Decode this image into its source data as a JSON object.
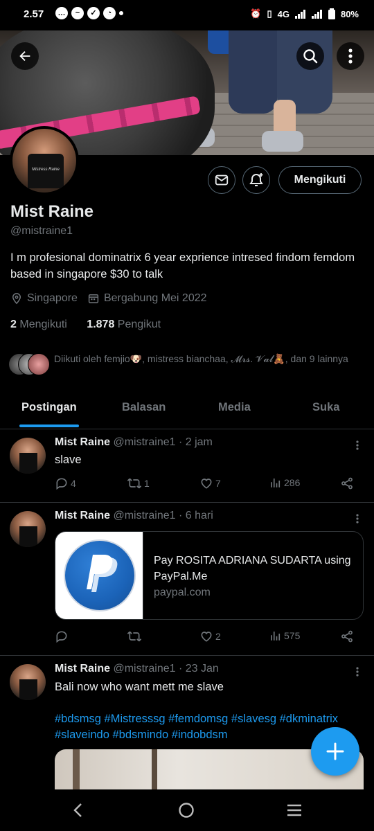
{
  "status_bar": {
    "time": "2.57",
    "battery": "80%",
    "network": "4G"
  },
  "profile": {
    "name": "Mist Raine",
    "handle": "@mistraine1",
    "bio": "I m profesional dominatrix 6 year exprience  intresed findom femdom based in singapore $30 to talk",
    "location": "Singapore",
    "joined": "Bergabung Mei 2022",
    "following_count": "2",
    "following_label": "Mengikuti",
    "followers_count": "1.878",
    "followers_label": "Pengikut",
    "follow_button": "Mengikuti",
    "avatar_caption": "Mistress Raine",
    "followed_by": "Diikuti oleh femjio🐶, mistress bianchaa, 𝓜𝓻𝓼. 𝓥𝓪𝓵🧸, dan 9 lainnya"
  },
  "tabs": [
    {
      "label": "Postingan",
      "active": true
    },
    {
      "label": "Balasan",
      "active": false
    },
    {
      "label": "Media",
      "active": false
    },
    {
      "label": "Suka",
      "active": false
    }
  ],
  "tweets": [
    {
      "name": "Mist Raine",
      "meta": "@mistraine1 · 2 jam",
      "text": "slave",
      "replies": "4",
      "retweets": "1",
      "likes": "7",
      "views": "286"
    },
    {
      "name": "Mist Raine",
      "meta": "@mistraine1 · 6 hari",
      "card_title": "Pay ROSITA ADRIANA SUDARTA using PayPal.Me",
      "card_domain": "paypal.com",
      "replies": "",
      "retweets": "",
      "likes": "2",
      "views": "575"
    },
    {
      "name": "Mist Raine",
      "meta": "@mistraine1 · 23 Jan",
      "text": "Bali now who want mett me slave",
      "hashtags": "#bdsmsg #Mistresssg #femdomsg #slavesg #dkminatrix #slaveindo #bdsmindo #indobdsm"
    }
  ],
  "colors": {
    "accent": "#1d9bf0",
    "background": "#000000",
    "muted": "#71767b"
  },
  "icons": [
    "back-arrow-icon",
    "search-icon",
    "more-vertical-icon",
    "mail-icon",
    "bell-plus-icon",
    "location-pin-icon",
    "calendar-icon",
    "reply-icon",
    "retweet-icon",
    "heart-icon",
    "views-icon",
    "share-icon",
    "plus-icon"
  ]
}
